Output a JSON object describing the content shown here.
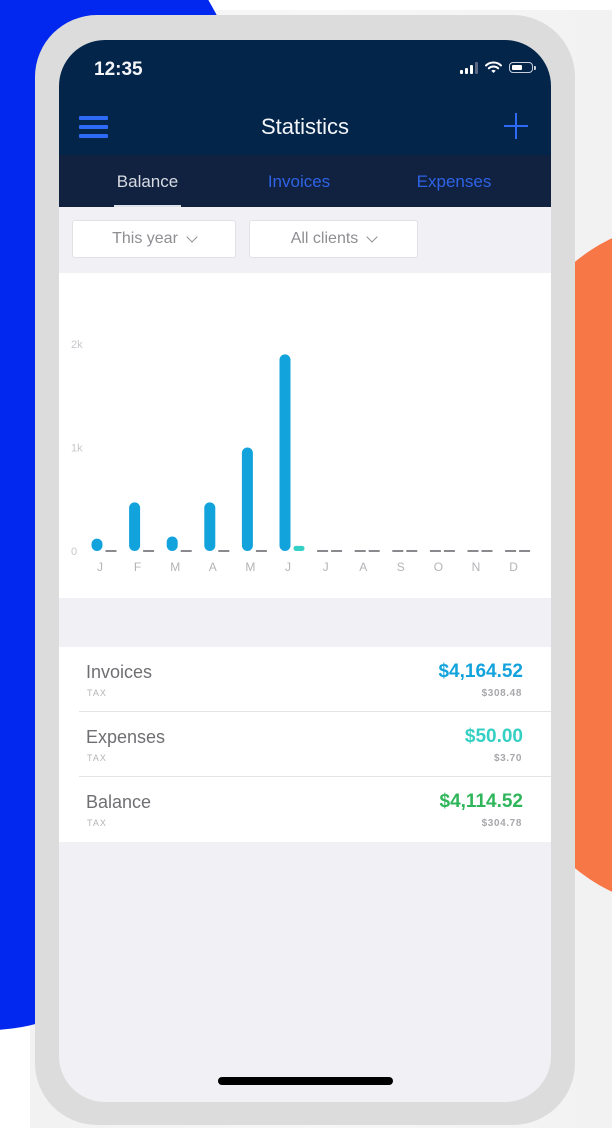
{
  "status_bar": {
    "time": "12:35",
    "icons": [
      "signal-icon",
      "wifi-icon",
      "battery-icon"
    ]
  },
  "nav": {
    "title": "Statistics",
    "menu_icon": "hamburger-menu-icon",
    "add_icon": "plus-icon"
  },
  "tabs": [
    {
      "label": "Balance",
      "active": true
    },
    {
      "label": "Invoices",
      "active": false
    },
    {
      "label": "Expenses",
      "active": false
    }
  ],
  "filters": {
    "period": {
      "value": "This year"
    },
    "clients": {
      "value": "All clients"
    }
  },
  "colors": {
    "invoices": "#13a3dc",
    "expenses": "#35d0c4",
    "balance": "#2fb55a",
    "empty": "#8a8a8e",
    "header": "#04254a",
    "accent": "#2d6af5"
  },
  "chart_data": {
    "type": "bar",
    "title": "",
    "xlabel": "",
    "ylabel": "",
    "categories": [
      "J",
      "F",
      "M",
      "A",
      "M",
      "J",
      "J",
      "A",
      "S",
      "O",
      "N",
      "D"
    ],
    "series": [
      {
        "name": "Invoices",
        "values": [
          120,
          470,
          140,
          470,
          1000,
          1900,
          0,
          0,
          0,
          0,
          0,
          0
        ]
      },
      {
        "name": "Expenses",
        "values": [
          0,
          0,
          0,
          0,
          0,
          50,
          0,
          0,
          0,
          0,
          0,
          0
        ]
      }
    ],
    "yticks": [
      "0",
      "1k",
      "2k"
    ],
    "ytick_values": [
      0,
      1000,
      2000
    ],
    "ylim": [
      0,
      2100
    ],
    "grid": false,
    "legend": "none"
  },
  "summary": [
    {
      "label": "Invoices",
      "sub": "TAX",
      "value": "$4,164.52",
      "tax": "$308.48",
      "color_key": "invoices"
    },
    {
      "label": "Expenses",
      "sub": "TAX",
      "value": "$50.00",
      "tax": "$3.70",
      "color_key": "expenses"
    },
    {
      "label": "Balance",
      "sub": "TAX",
      "value": "$4,114.52",
      "tax": "$304.78",
      "color_key": "balance"
    }
  ]
}
